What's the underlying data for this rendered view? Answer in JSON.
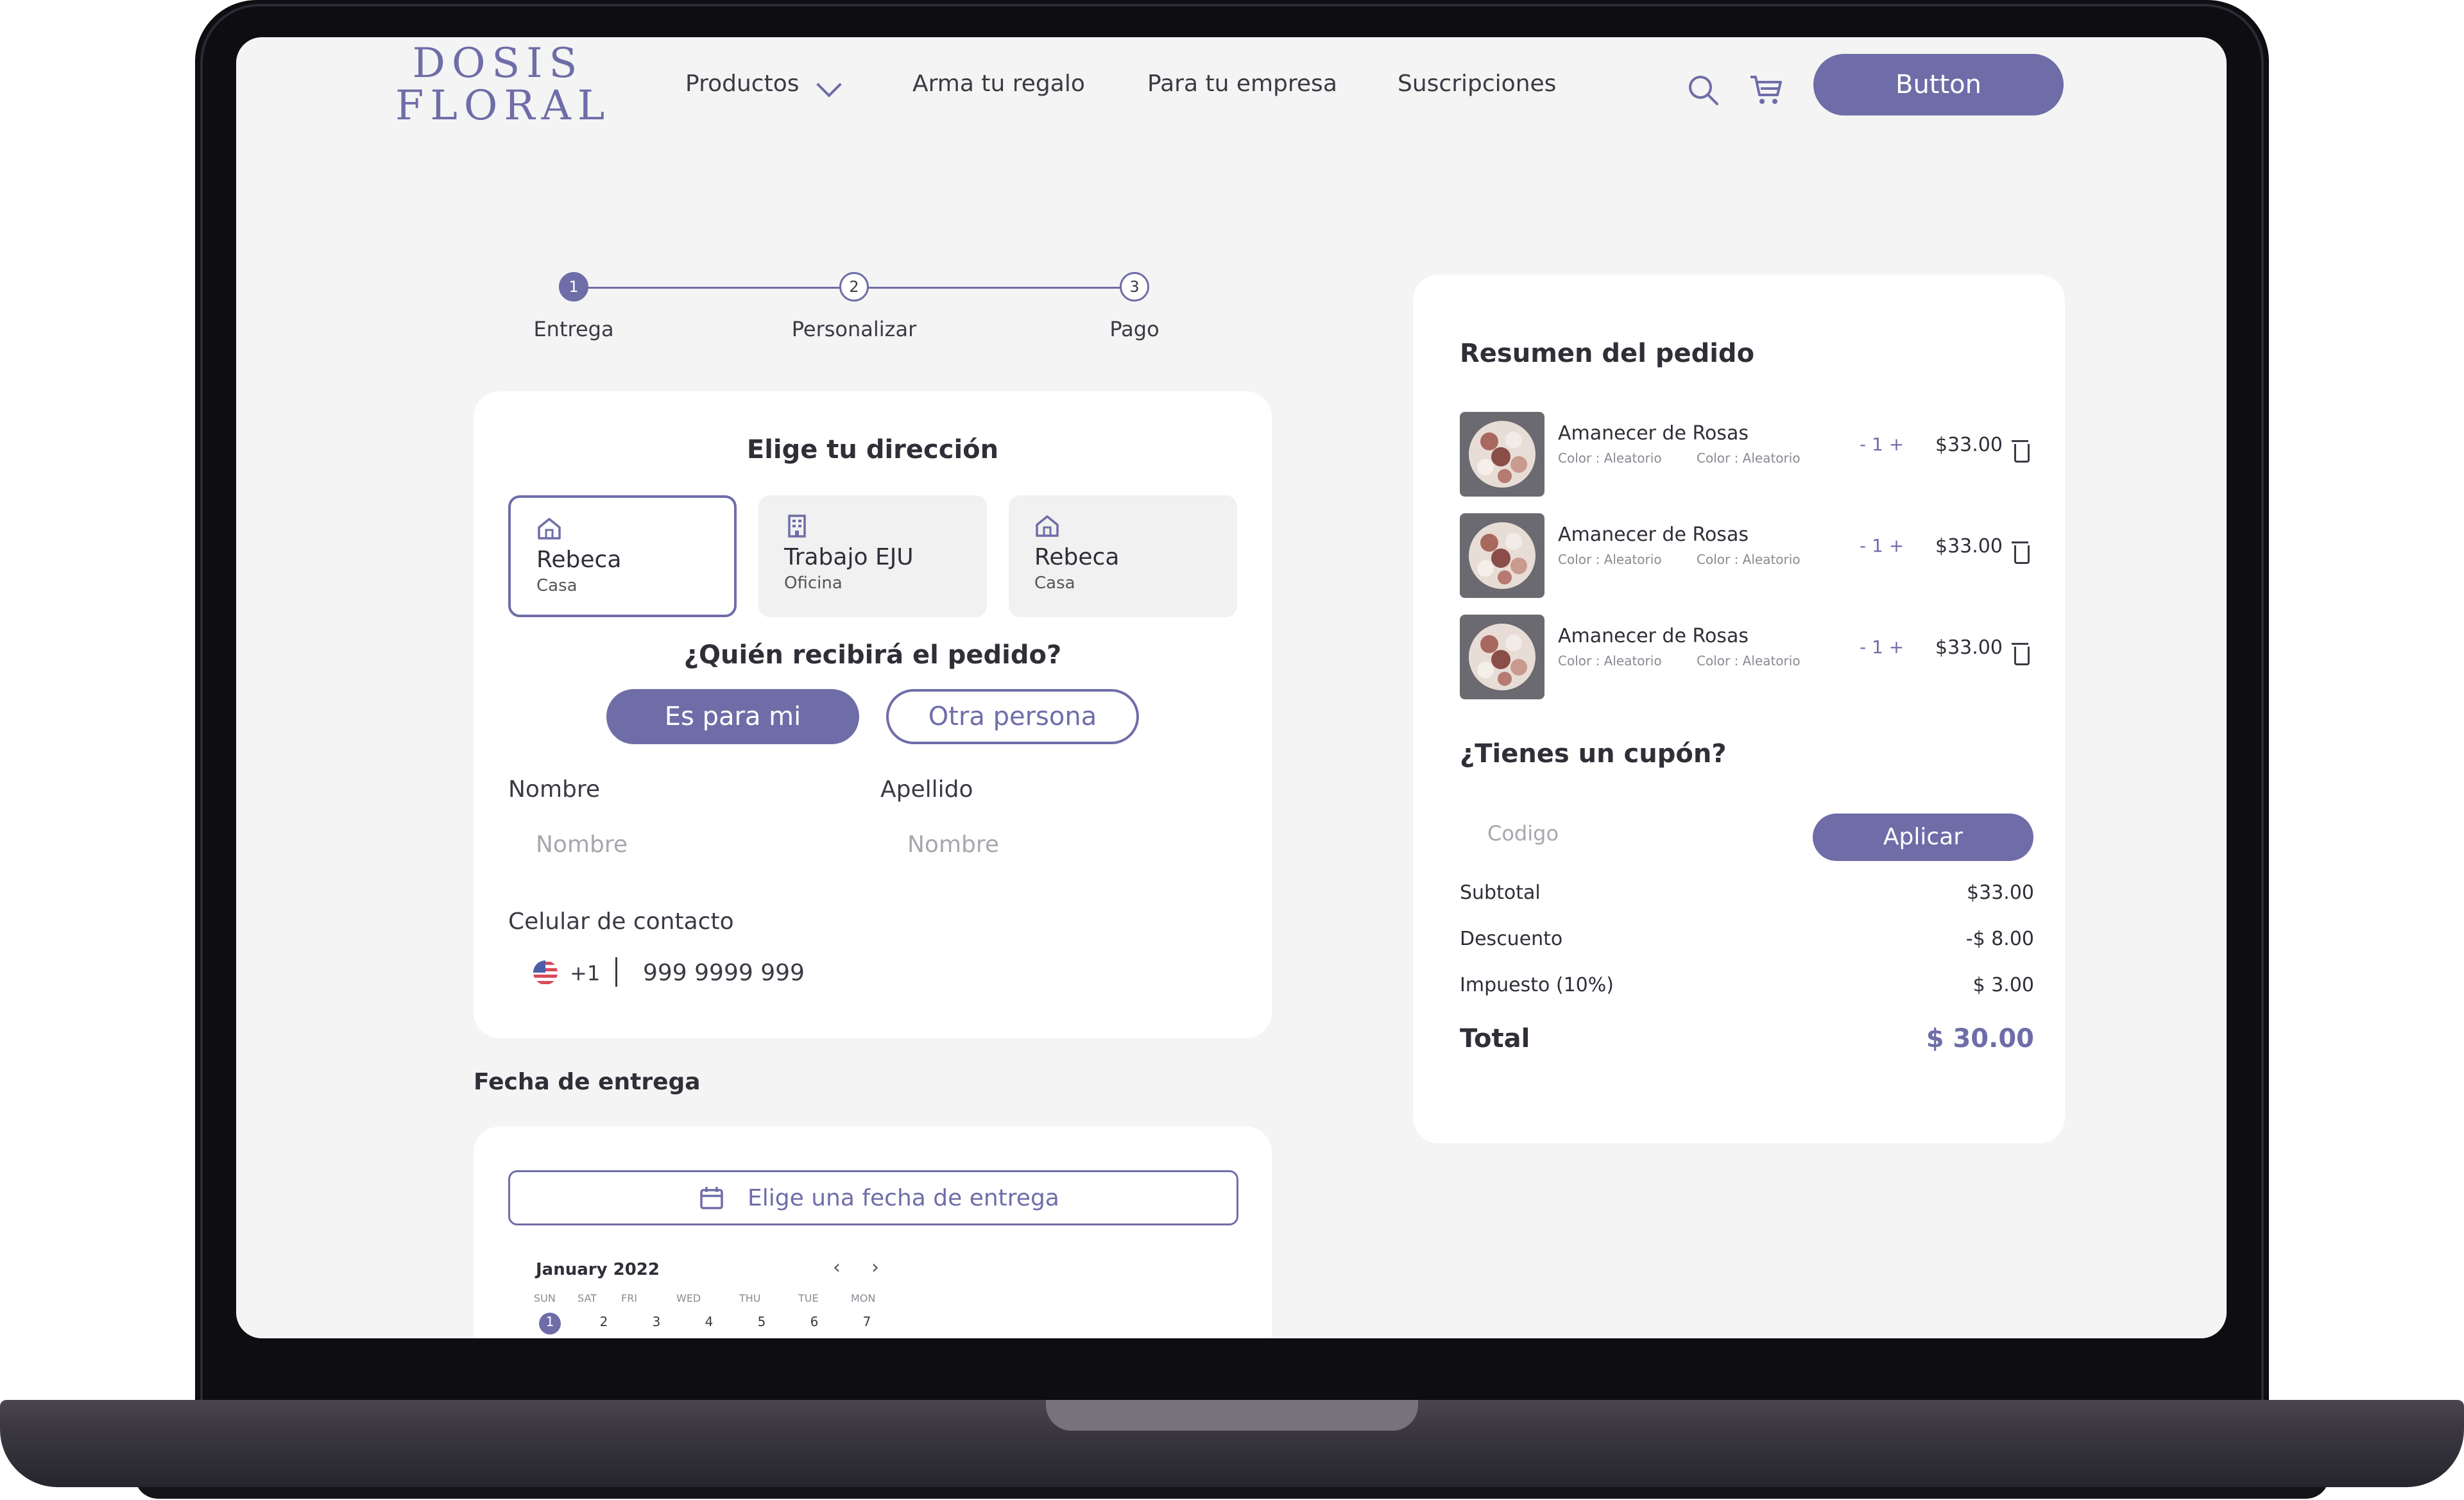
{
  "header": {
    "logo_line1": "DOSIS",
    "logo_line2": "FLORAL",
    "nav": [
      "Productos",
      "Arma tu regalo",
      "Para tu empresa",
      "Suscripciones"
    ],
    "cta_label": "Button"
  },
  "stepper": {
    "steps": [
      {
        "number": "1",
        "label": "Entrega"
      },
      {
        "number": "2",
        "label": "Personalizar"
      },
      {
        "number": "3",
        "label": "Pago"
      }
    ]
  },
  "address": {
    "title": "Elige tu dirección",
    "options": [
      {
        "name": "Rebeca",
        "type": "Casa"
      },
      {
        "name": "Trabajo EJU",
        "type": "Oficina"
      },
      {
        "name": "Rebeca",
        "type": "Casa"
      }
    ]
  },
  "recipient": {
    "title": "¿Quién recibirá el pedido?",
    "self_label": "Es para mi",
    "other_label": "Otra persona",
    "first_name_label": "Nombre",
    "first_name_placeholder": "Nombre",
    "last_name_label": "Apellido",
    "last_name_placeholder": "Nombre",
    "phone_label": "Celular de contacto",
    "phone_prefix": "+1",
    "phone_value": "999 9999 999"
  },
  "delivery": {
    "title": "Fecha de entrega",
    "picker_label": "Elige una fecha de entrega",
    "month": "January 2022",
    "prev": "‹",
    "next": "›",
    "weekdays": [
      "SUN",
      "SAT",
      "FRI",
      "WED",
      "THU",
      "TUE",
      "MON"
    ],
    "days": [
      "1",
      "2",
      "3",
      "4",
      "5",
      "6",
      "7"
    ]
  },
  "summary": {
    "title": "Resumen del pedido",
    "items": [
      {
        "name": "Amanecer de Rosas",
        "meta1": "Color : Aleatorio",
        "meta2": "Color : Aleatorio",
        "qty": "- 1 +",
        "price": "$33.00"
      },
      {
        "name": "Amanecer de Rosas",
        "meta1": "Color : Aleatorio",
        "meta2": "Color : Aleatorio",
        "qty": "- 1 +",
        "price": "$33.00"
      },
      {
        "name": "Amanecer de Rosas",
        "meta1": "Color : Aleatorio",
        "meta2": "Color : Aleatorio",
        "qty": "- 1 +",
        "price": "$33.00"
      }
    ],
    "coupon_title": "¿Tienes un cupón?",
    "coupon_placeholder": "Codigo",
    "apply_label": "Aplicar",
    "subtotal_label": "Subtotal",
    "subtotal_value": "$33.00",
    "discount_label": "Descuento",
    "discount_value": "-$ 8.00",
    "tax_label": "Impuesto (10%)",
    "tax_value": "$ 3.00",
    "total_label": "Total",
    "total_value": "$ 30.00"
  },
  "colors": {
    "accent": "#6f6da8",
    "screen_bg": "#f4f4f4",
    "card_bg": "#ffffff"
  }
}
